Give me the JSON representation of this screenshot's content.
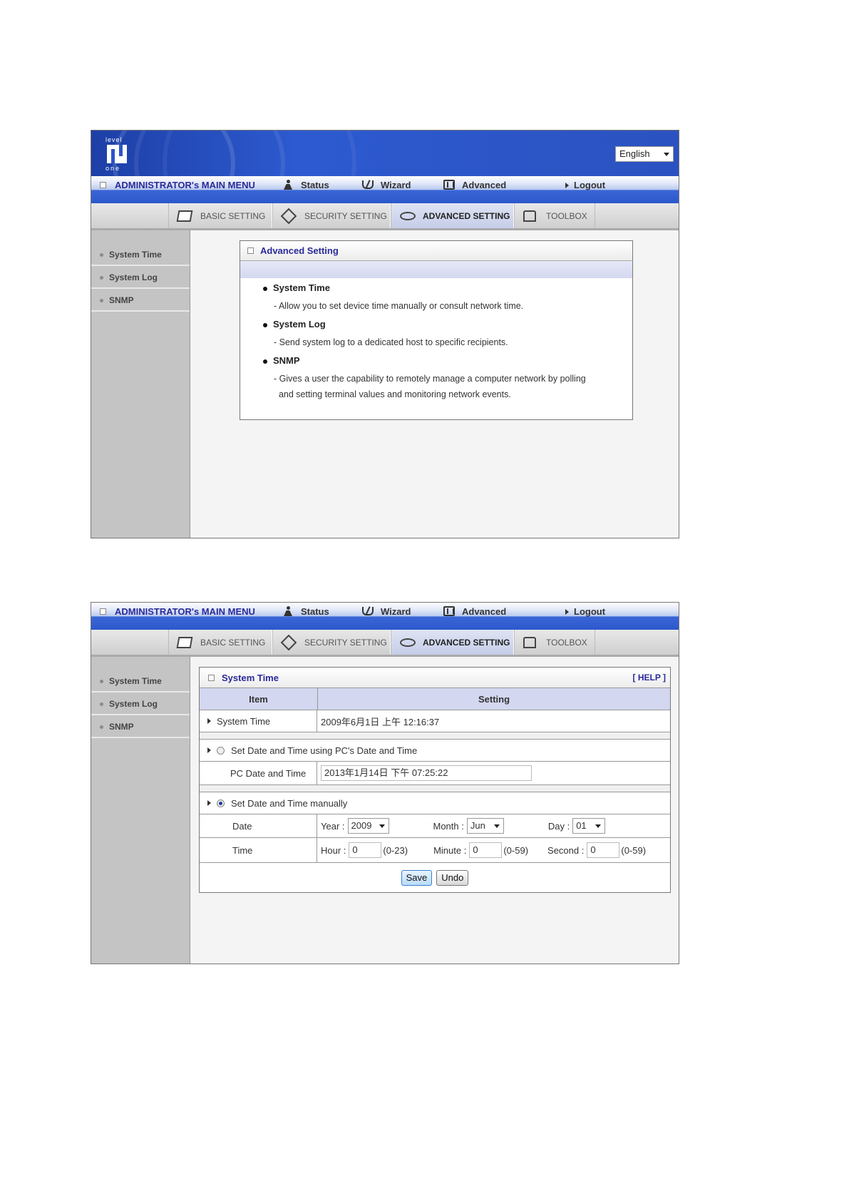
{
  "lang": {
    "selected": "English"
  },
  "menu": {
    "title": "ADMINISTRATOR's MAIN MENU",
    "status": "Status",
    "wizard": "Wizard",
    "advanced": "Advanced",
    "logout": "Logout"
  },
  "tabs": {
    "basic": "BASIC SETTING",
    "security": "SECURITY SETTING",
    "advanced": "ADVANCED SETTING",
    "toolbox": "TOOLBOX"
  },
  "sidebar": {
    "items": [
      {
        "label": "System Time"
      },
      {
        "label": "System Log"
      },
      {
        "label": "SNMP"
      }
    ]
  },
  "overview": {
    "title": "Advanced Setting",
    "items": [
      {
        "name": "System Time",
        "desc": "Allow you to set device time manually or consult network time."
      },
      {
        "name": "System Log",
        "desc": "Send system log to a dedicated host to specific recipients."
      },
      {
        "name": "SNMP",
        "desc1": "Gives a user the capability to remotely manage a computer network by polling",
        "desc2": "and setting terminal values and monitoring network events."
      }
    ]
  },
  "form": {
    "title": "System Time",
    "help": "[ HELP ]",
    "col_item": "Item",
    "col_setting": "Setting",
    "system_time_label": "System Time",
    "system_time_value": "2009年6月1日 上午 12:16:37",
    "opt_pc": "Set Date and Time using PC's Date and Time",
    "pc_label": "PC Date and Time",
    "pc_value": "2013年1月14日 下午 07:25:22",
    "opt_manual": "Set Date and Time manually",
    "date_label": "Date",
    "year_label": "Year :",
    "year_value": "2009",
    "month_label": "Month :",
    "month_value": "Jun",
    "day_label": "Day :",
    "day_value": "01",
    "time_label": "Time",
    "hour_label": "Hour :",
    "hour_value": "0",
    "hour_range": "(0-23)",
    "minute_label": "Minute :",
    "minute_value": "0",
    "minute_range": "(0-59)",
    "second_label": "Second :",
    "second_value": "0",
    "second_range": "(0-59)",
    "save": "Save",
    "undo": "Undo"
  }
}
